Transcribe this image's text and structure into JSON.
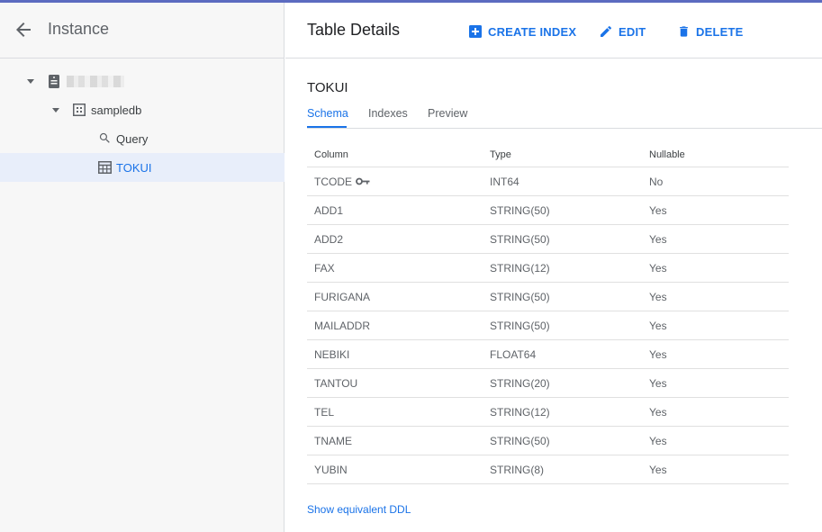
{
  "left_panel": {
    "title": "Instance",
    "tree": {
      "instance_label": "",
      "database": "sampledb",
      "query": "Query",
      "table": "TOKUI"
    }
  },
  "header": {
    "title": "Table Details",
    "actions": {
      "create_index": "CREATE INDEX",
      "edit": "EDIT",
      "delete": "DELETE"
    }
  },
  "table_name": "TOKUI",
  "tabs": [
    "Schema",
    "Indexes",
    "Preview"
  ],
  "schema": {
    "columns": [
      "Column",
      "Type",
      "Nullable"
    ],
    "rows": [
      {
        "column": "TCODE",
        "type": "INT64",
        "nullable": "No",
        "primary_key": true
      },
      {
        "column": "ADD1",
        "type": "STRING(50)",
        "nullable": "Yes"
      },
      {
        "column": "ADD2",
        "type": "STRING(50)",
        "nullable": "Yes"
      },
      {
        "column": "FAX",
        "type": "STRING(12)",
        "nullable": "Yes"
      },
      {
        "column": "FURIGANA",
        "type": "STRING(50)",
        "nullable": "Yes"
      },
      {
        "column": "MAILADDR",
        "type": "STRING(50)",
        "nullable": "Yes"
      },
      {
        "column": "NEBIKI",
        "type": "FLOAT64",
        "nullable": "Yes"
      },
      {
        "column": "TANTOU",
        "type": "STRING(20)",
        "nullable": "Yes"
      },
      {
        "column": "TEL",
        "type": "STRING(12)",
        "nullable": "Yes"
      },
      {
        "column": "TNAME",
        "type": "STRING(50)",
        "nullable": "Yes"
      },
      {
        "column": "YUBIN",
        "type": "STRING(8)",
        "nullable": "Yes"
      }
    ]
  },
  "ddl_link": "Show equivalent DDL",
  "colors": {
    "accent": "#1a73e8",
    "selected_row": "#e8eefa"
  }
}
